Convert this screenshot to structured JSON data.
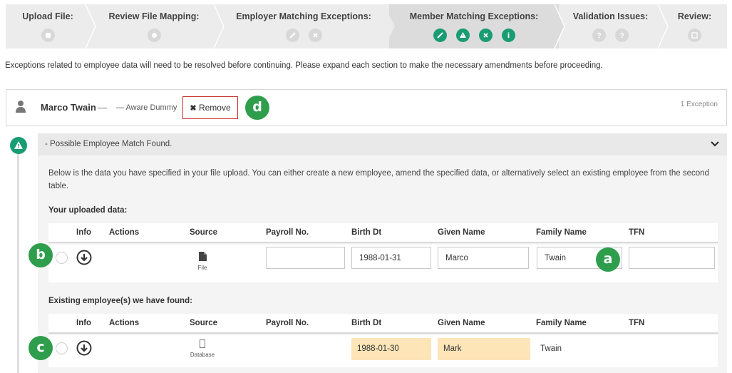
{
  "steps": [
    {
      "title": "Upload File:",
      "icons": [
        "calendar-icon"
      ],
      "active": false
    },
    {
      "title": "Review File Mapping:",
      "icons": [
        "gear-icon"
      ],
      "active": false
    },
    {
      "title": "Employer Matching Exceptions:",
      "icons": [
        "pencil-icon",
        "close-icon"
      ],
      "active": false
    },
    {
      "title": "Member Matching Exceptions:",
      "icons": [
        "pencil-icon",
        "warning-icon",
        "close-icon",
        "info-icon"
      ],
      "active": true
    },
    {
      "title": "Validation Issues:",
      "icons": [
        "question-icon",
        "question-icon"
      ],
      "active": false
    },
    {
      "title": "Review:",
      "icons": [
        "edit-icon"
      ],
      "active": false
    }
  ],
  "intro_text": "Exceptions related to employee data will need to be resolved before continuing. Please expand each section to make the necessary amendments before proceeding.",
  "employee": {
    "name": "Marco Twain",
    "dash": "—",
    "employer": "— Aware Dummy",
    "remove_label": "Remove",
    "exception_count": "1 Exception"
  },
  "callouts": {
    "a": "a",
    "b": "b",
    "c": "c",
    "d": "d"
  },
  "exception": {
    "header": "- Possible Employee Match Found.",
    "description": "Below is the data you have specified in your file upload. You can either create a new employee, amend the specified data, or alternatively select an existing employee from the second table.",
    "uploaded_label": "Your uploaded data:",
    "existing_label": "Existing employee(s) we have found:",
    "columns": [
      "Info",
      "Actions",
      "Source",
      "Payroll No.",
      "Birth Dt",
      "Given Name",
      "Family Name",
      "TFN"
    ],
    "uploaded_row": {
      "source": "File",
      "payroll_no": "",
      "birth_dt": "1988-01-31",
      "given_name": "Marco",
      "family_name": "Twain",
      "tfn": ""
    },
    "existing_row": {
      "source": "Database",
      "payroll_no": "",
      "birth_dt": "1988-01-30",
      "given_name": "Mark",
      "family_name": "Twain",
      "tfn": ""
    }
  },
  "colors": {
    "accent": "#1a9c73",
    "callout": "#2f9e4c",
    "remove_border": "#c9302c",
    "mismatch_highlight": "#fde5b8"
  }
}
